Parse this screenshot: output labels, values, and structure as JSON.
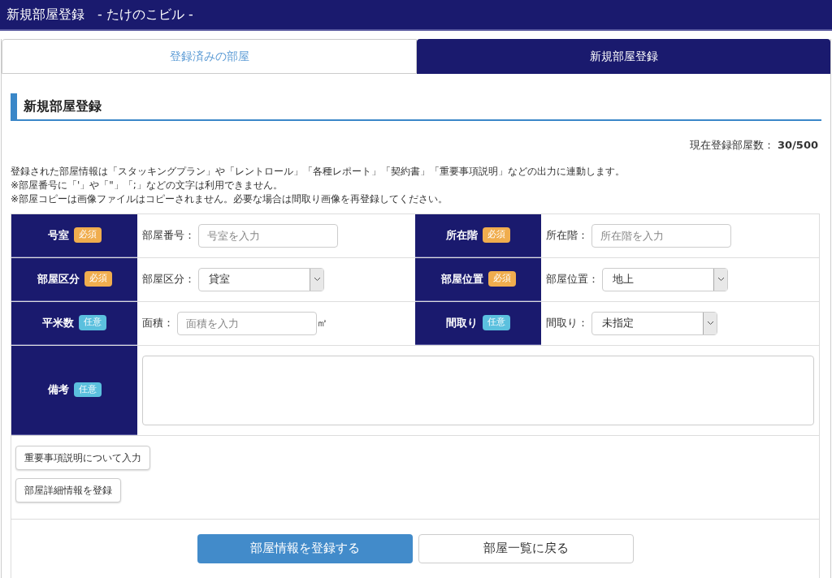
{
  "header": {
    "title": "新規部屋登録　- たけのこビル -"
  },
  "tabs": [
    {
      "label": "登録済みの部屋",
      "selected": false
    },
    {
      "label": "新規部屋登録",
      "selected": true
    }
  ],
  "section_title": "新規部屋登録",
  "room_count": "現在登録部屋数： **30/500**",
  "notes": [
    "登録された部屋情報は「スタッキングプラン」や「レントロール」「各種レポート」「契約書」「重要事項説明」などの出力に連動します。",
    "※部屋番号に「'」や「\"」「;」などの文字は利用できません。",
    "※部屋コピーは画像ファイルはコピーされません。必要な場合は間取り画像を再登録してください。"
  ],
  "form_rows": [
    {
      "cells": [
        {
          "label": "号室",
          "badge": {
            "text": "必須",
            "kind": "required"
          },
          "field_label": "部屋番号：",
          "kind": "input",
          "placeholder": "号室を入力"
        },
        {
          "label": "所在階",
          "badge": {
            "text": "必須",
            "kind": "required"
          },
          "field_label": "所在階：",
          "kind": "input",
          "placeholder": "所在階を入力"
        }
      ]
    },
    {
      "cells": [
        {
          "label": "部屋区分",
          "badge": {
            "text": "必須",
            "kind": "required"
          },
          "field_label": "部屋区分：",
          "kind": "select",
          "value": "貸室"
        },
        {
          "label": "部屋位置",
          "badge": {
            "text": "必須",
            "kind": "required"
          },
          "field_label": "部屋位置：",
          "kind": "select",
          "value": "地上"
        }
      ]
    },
    {
      "cells": [
        {
          "label": "平米数",
          "badge": {
            "text": "任意",
            "kind": "optional"
          },
          "field_label": "面積：",
          "kind": "input",
          "placeholder": "面積を入力",
          "unit": "㎡"
        },
        {
          "label": "間取り",
          "badge": {
            "text": "任意",
            "kind": "optional"
          },
          "field_label": "間取り：",
          "kind": "select",
          "value": "未指定"
        }
      ]
    },
    {
      "cells": [
        {
          "label": "備考",
          "badge": {
            "text": "任意",
            "kind": "optional"
          },
          "kind": "textarea"
        }
      ]
    }
  ],
  "extra_buttons": [
    "重要事項説明について入力",
    "部屋詳細情報を登録"
  ],
  "actions": [
    {
      "label": "部屋情報を登録する",
      "kind": "primary"
    },
    {
      "label": "部屋一覧に戻る",
      "kind": "secondary"
    }
  ]
}
